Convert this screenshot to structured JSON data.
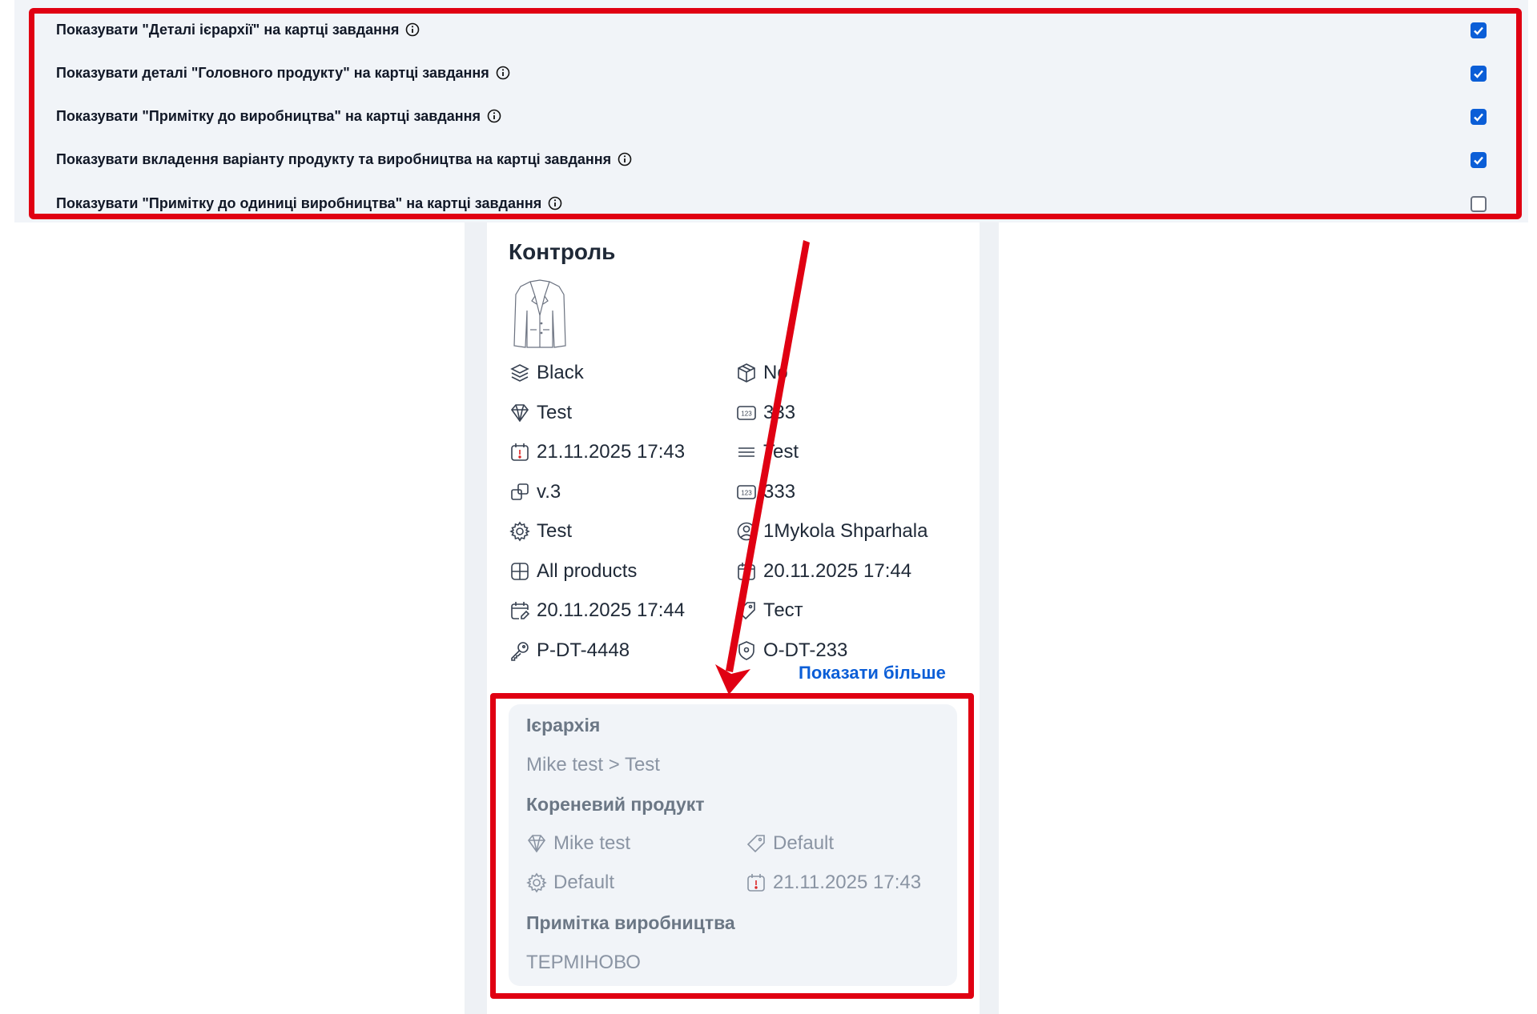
{
  "settings": [
    {
      "label": "Показувати \"Деталі ієрархії\" на картці завдання",
      "checked": true
    },
    {
      "label": "Показувати деталі \"Головного продукту\" на картці завдання",
      "checked": true
    },
    {
      "label": "Показувати \"Примітку до виробництва\" на картці завдання",
      "checked": true
    },
    {
      "label": "Показувати вкладення варіанту продукту та виробництва на картці завдання",
      "checked": true
    },
    {
      "label": "Показувати \"Примітку до одиниці виробництва\" на картці завдання",
      "checked": false
    }
  ],
  "card": {
    "title": "Контроль",
    "left_attrs": [
      {
        "icon": "layers-icon",
        "value": "Black"
      },
      {
        "icon": "diamond-icon",
        "value": "Test"
      },
      {
        "icon": "calendar-alert-icon",
        "value": "21.11.2025 17:43"
      },
      {
        "icon": "versions-icon",
        "value": "v.3"
      },
      {
        "icon": "gear-icon",
        "value": "Test"
      },
      {
        "icon": "grid-icon",
        "value": "All products"
      },
      {
        "icon": "calendar-edit-icon",
        "value": "20.11.2025 17:44"
      },
      {
        "icon": "key-icon",
        "value": "P-DT-4448"
      }
    ],
    "right_attrs": [
      {
        "icon": "box-icon",
        "value": "No"
      },
      {
        "icon": "number-icon",
        "value": "333"
      },
      {
        "icon": "menu-icon",
        "value": "Test"
      },
      {
        "icon": "number-icon",
        "value": "333"
      },
      {
        "icon": "user-icon",
        "value": "1Mykola Shparhala"
      },
      {
        "icon": "calendar-icon",
        "value": "20.11.2025 17:44"
      },
      {
        "icon": "tag-icon",
        "value": "Тест"
      },
      {
        "icon": "shield-icon",
        "value": "O-DT-233"
      }
    ],
    "show_more": "Показати більше",
    "details": {
      "hierarchy_heading": "Ієрархія",
      "hierarchy_value": "Mike test > Test",
      "root_product_heading": "Кореневий продукт",
      "root_attrs": [
        {
          "icon": "diamond-icon",
          "value": "Mike test"
        },
        {
          "icon": "tag-icon",
          "value": "Default"
        },
        {
          "icon": "gear-icon",
          "value": "Default"
        },
        {
          "icon": "calendar-alert-icon",
          "value": "21.11.2025 17:43"
        }
      ],
      "production_note_heading": "Примітка виробництва",
      "production_note_value": "ТЕРМІНОВО"
    }
  },
  "colors": {
    "highlight": "#e00012",
    "accent": "#0b5ed7",
    "panel_bg": "#f1f4f8"
  }
}
